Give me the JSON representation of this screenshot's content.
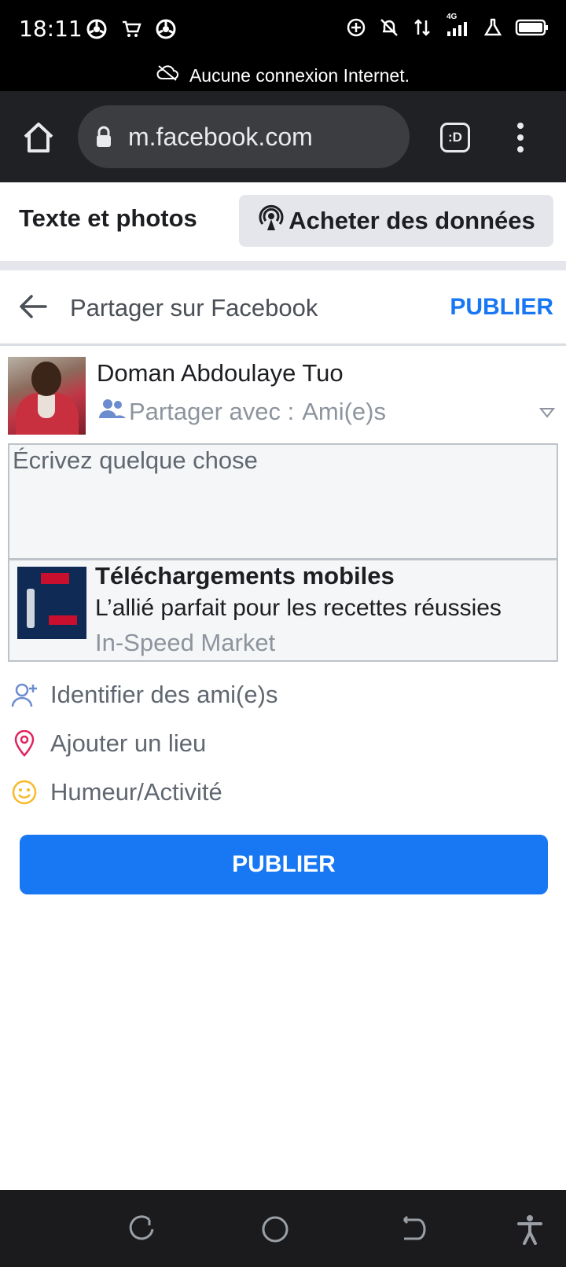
{
  "status_bar": {
    "time": "18:11",
    "network_label": "4G"
  },
  "offline_banner": {
    "text": "Aucune connexion Internet."
  },
  "browser": {
    "url": "m.facebook.com",
    "tab_switcher_label": ":D"
  },
  "top_bar": {
    "title": "Texte et photos",
    "buy_data_label": "Acheter des données"
  },
  "share_header": {
    "title": "Partager sur Facebook",
    "publish_label": "PUBLIER"
  },
  "user": {
    "name": "Doman Abdoulaye Tuo",
    "audience_prefix": "Partager avec :",
    "audience_value": "Ami(e)s"
  },
  "composer": {
    "placeholder": "Écrivez quelque chose"
  },
  "link_preview": {
    "title": "Téléchargements mobiles",
    "description": "L’allié parfait pour les recettes réussies",
    "domain": "In-Speed Market"
  },
  "actions": {
    "tag_friends": "Identifier des ami(e)s",
    "add_place": "Ajouter un lieu",
    "mood": "Humeur/Activité"
  },
  "publish_button": {
    "label": "PUBLIER"
  },
  "colors": {
    "accent": "#1877f2",
    "place_icon": "#e0245e",
    "mood_icon": "#f7b928",
    "status_bar": "#000000",
    "browser_bar": "#202124"
  }
}
